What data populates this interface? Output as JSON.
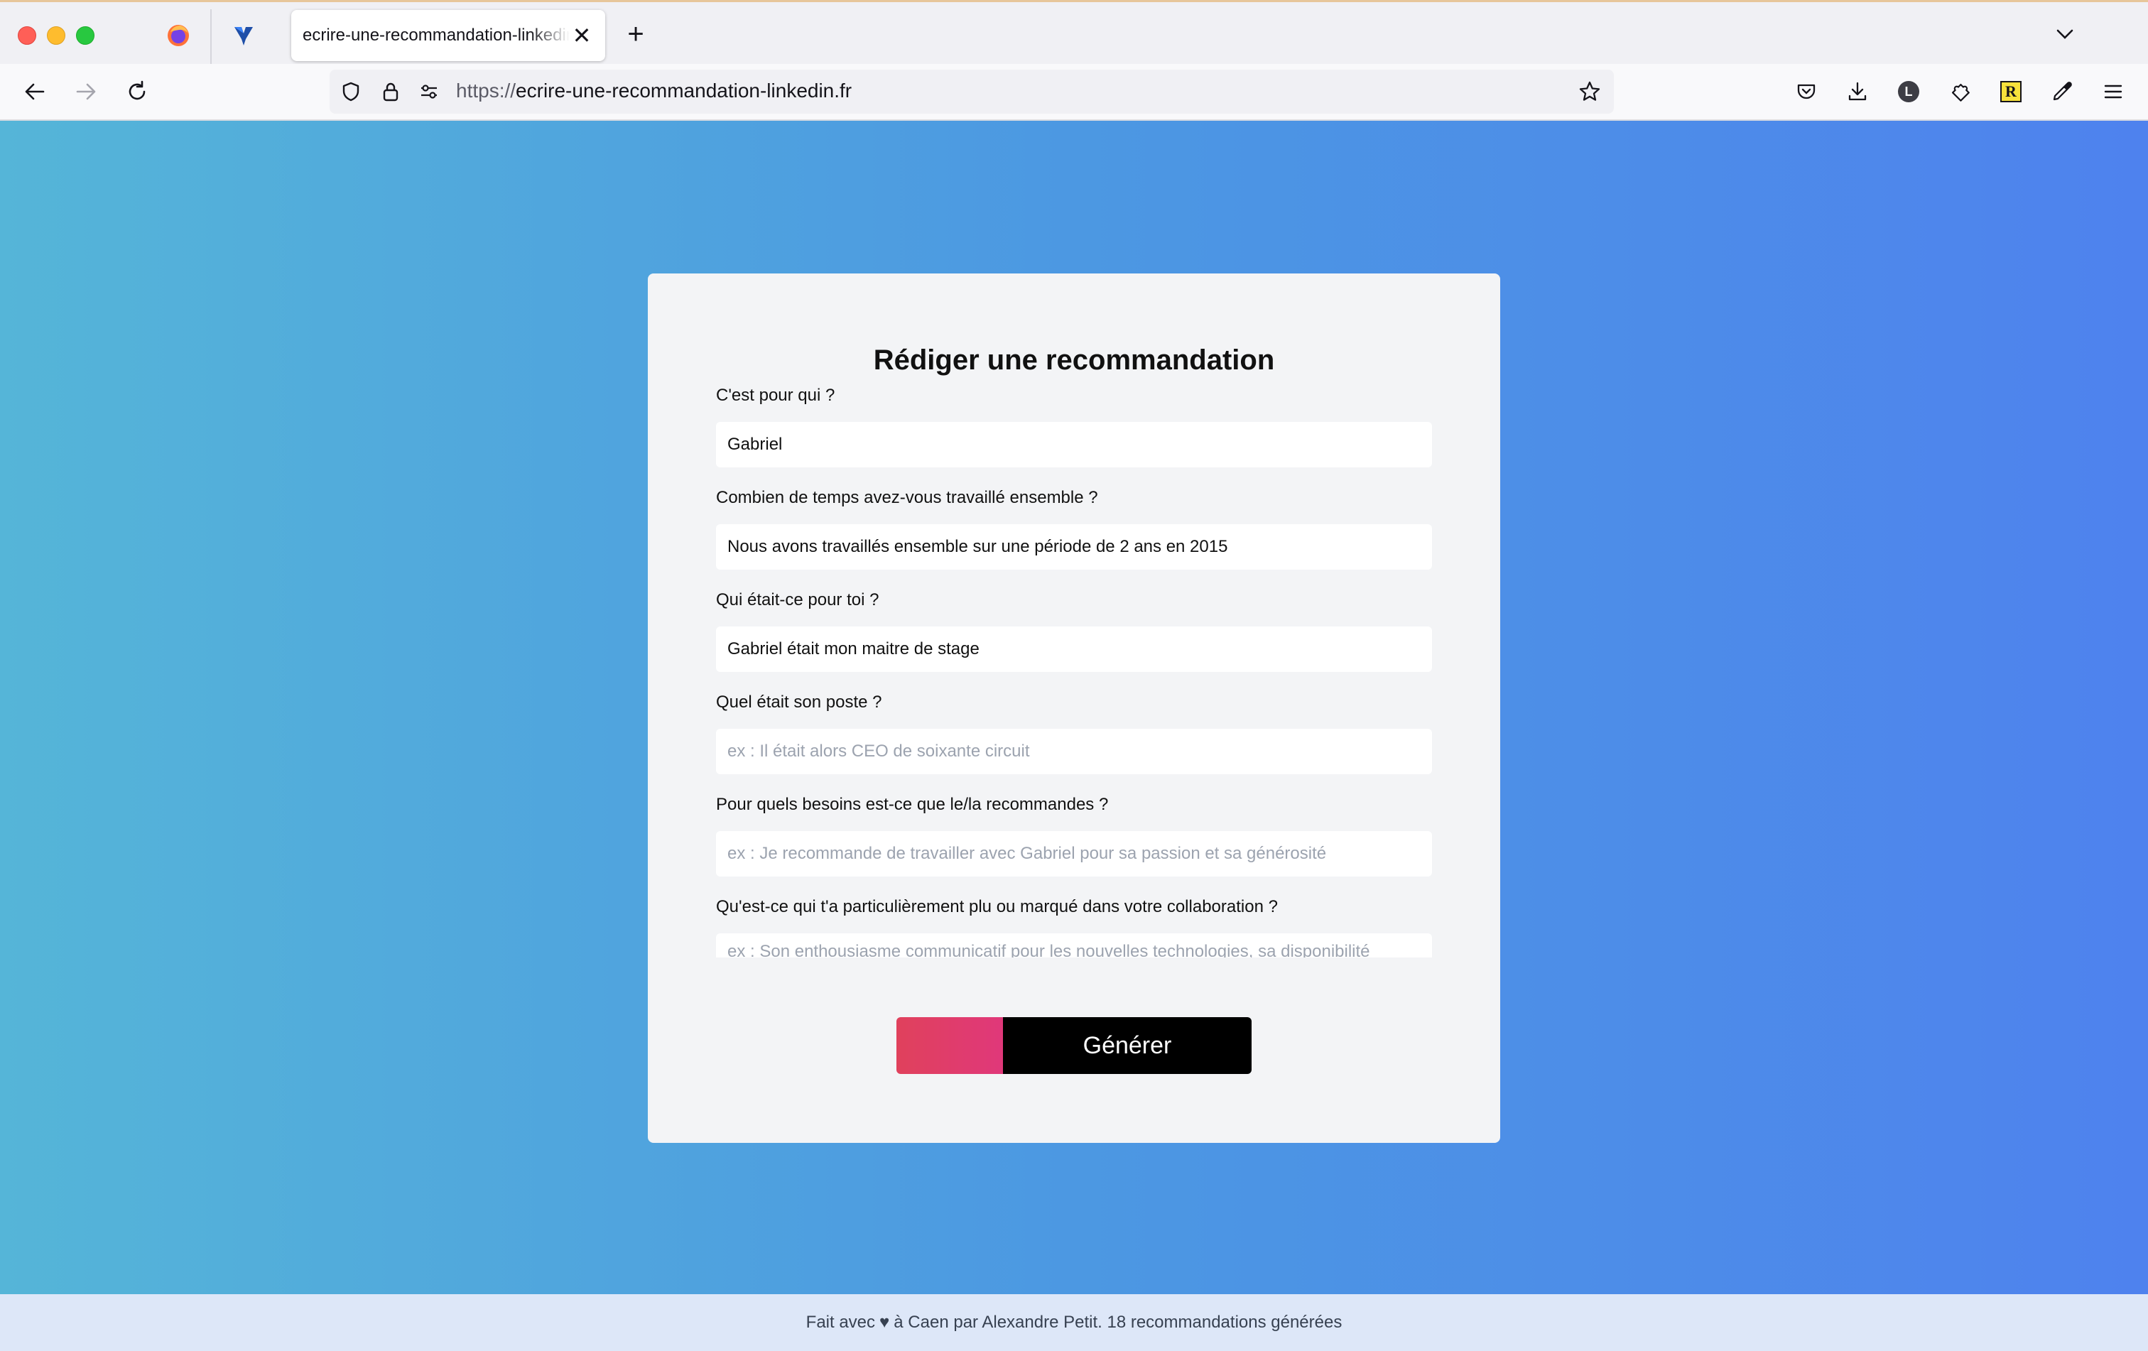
{
  "browser": {
    "tab_title": "ecrire-une-recommandation-linkedin.fr",
    "tab_close": "✕",
    "new_tab": "+",
    "url_scheme": "https://",
    "url_host": "ecrire-une-recommandation-linkedin.fr",
    "extension_r": "R",
    "extension_l": "L"
  },
  "form": {
    "title": "Rédiger une recommandation",
    "fields": [
      {
        "label": "C'est pour qui ?",
        "value": "Gabriel",
        "placeholder": ""
      },
      {
        "label": "Combien de temps avez-vous travaillé ensemble ?",
        "value": "Nous avons travaillés ensemble sur une période de 2 ans en 2015",
        "placeholder": ""
      },
      {
        "label": "Qui était-ce pour toi ?",
        "value": "Gabriel était mon maitre de stage",
        "placeholder": ""
      },
      {
        "label": "Quel était son poste ?",
        "value": "",
        "placeholder": "ex : Il était alors CEO de soixante circuit"
      },
      {
        "label": "Pour quels besoins est-ce que le/la recommandes ?",
        "value": "",
        "placeholder": "ex : Je recommande de travailler avec Gabriel pour sa passion et sa générosité"
      },
      {
        "label": "Qu'est-ce qui t'a particulièrement plu ou marqué dans votre collaboration ?",
        "value": "",
        "placeholder": "ex : Son enthousiasme communicatif pour les nouvelles technologies, sa disponibilité"
      }
    ],
    "submit_label": "Générer"
  },
  "footer": {
    "prefix": "Fait avec",
    "heart": "♥",
    "suffix": "à Caen par Alexandre Petit. 18 recommandations générées"
  },
  "colors": {
    "gradient_start": "#55b5d8",
    "gradient_end": "#4e82ee",
    "button_accent": "#e0415c",
    "button_bg": "#000000"
  }
}
